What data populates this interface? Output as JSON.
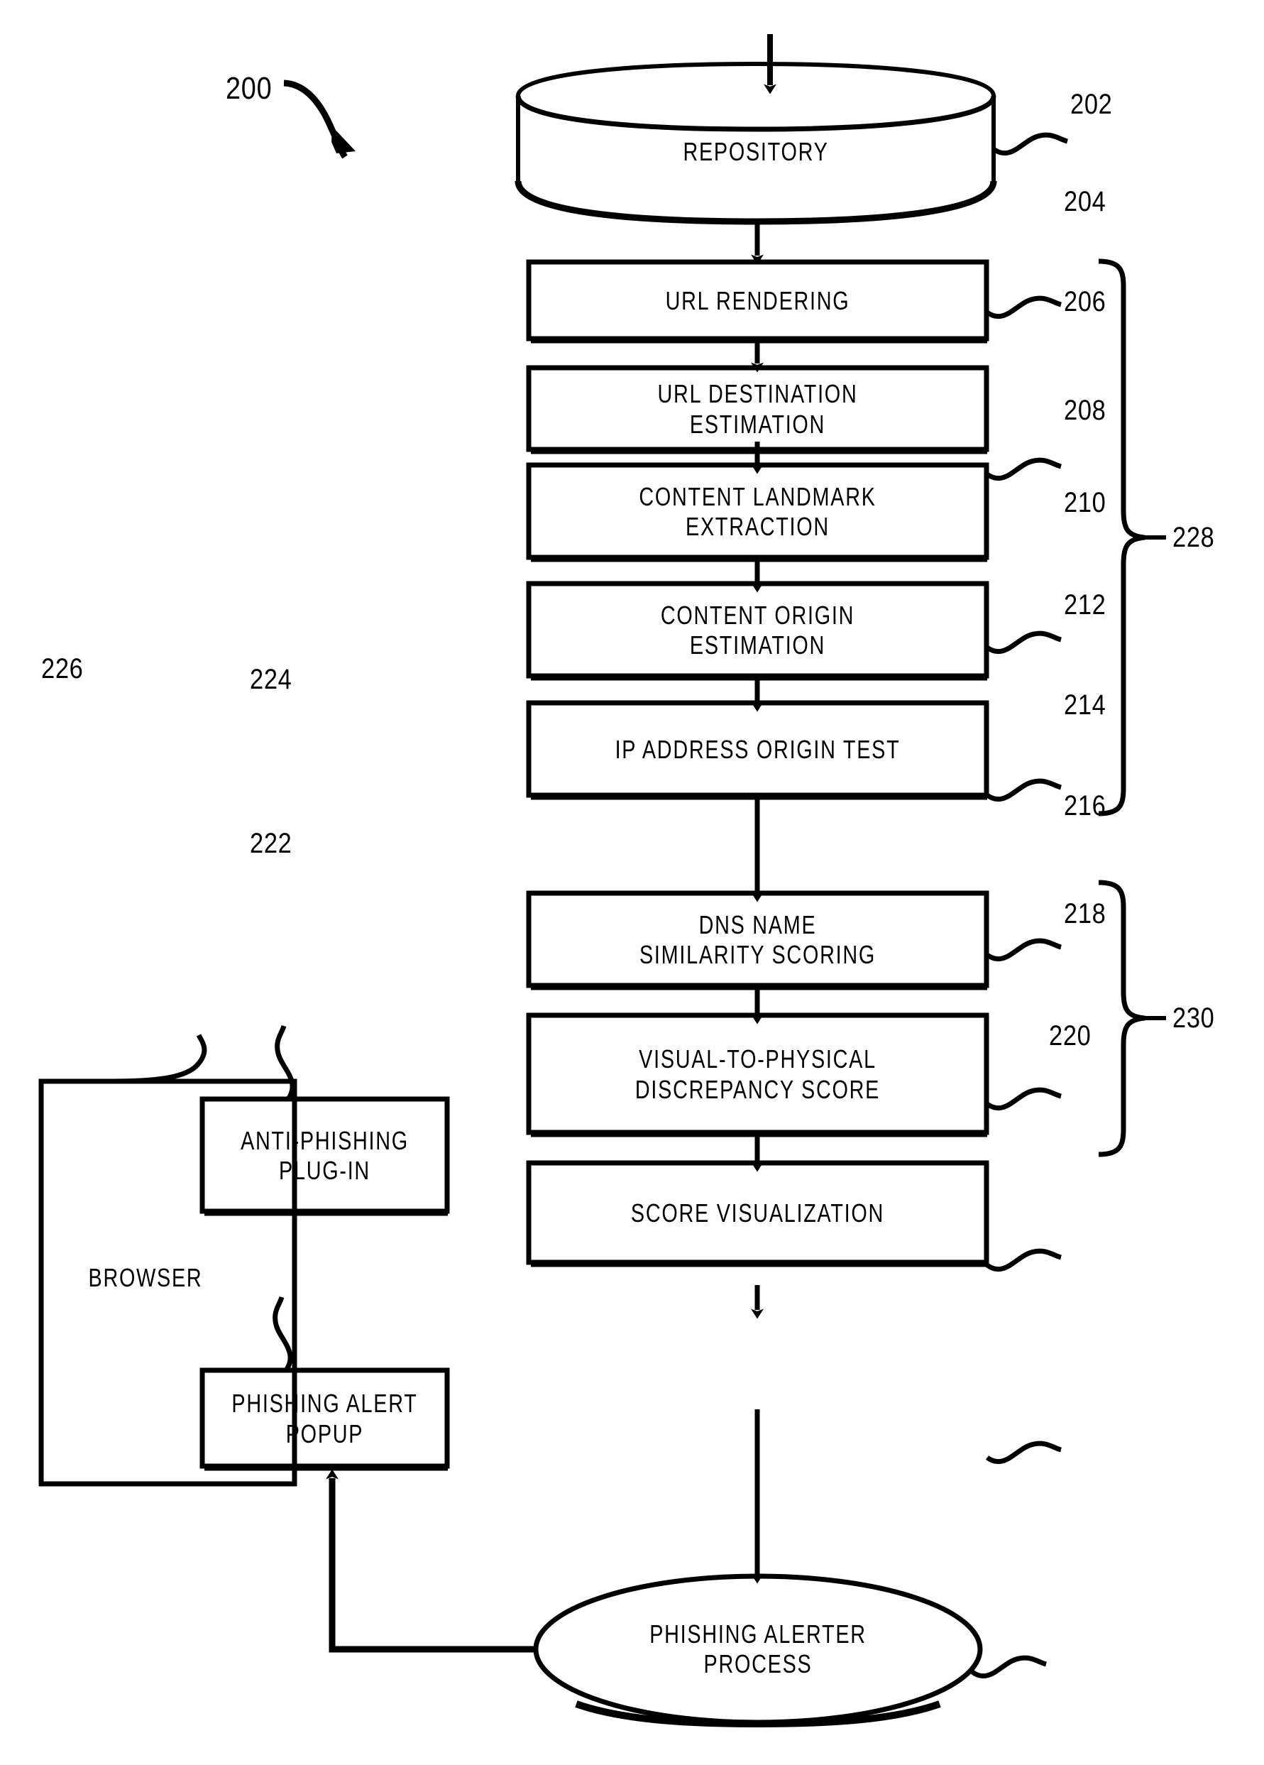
{
  "figure": {
    "number": "200",
    "title": "Anti-phishing detection pipeline block diagram"
  },
  "nodes": {
    "repository": {
      "label": "REPOSITORY",
      "ref": "202",
      "shape": "cylinder"
    },
    "url_rendering": {
      "label": "URL  RENDERING",
      "ref": "204",
      "shape": "process"
    },
    "url_destination_estimation": {
      "label": "URL  DESTINATION\nESTIMATION",
      "ref": "206",
      "shape": "process"
    },
    "content_landmark_extraction": {
      "label": "CONTENT  LANDMARK\nEXTRACTION",
      "ref": "208",
      "shape": "process"
    },
    "content_origin_estimation": {
      "label": "CONTENT  ORIGIN\nESTIMATION",
      "ref": "210",
      "shape": "process"
    },
    "ip_address_origin_test": {
      "label": "IP  ADDRESS  ORIGIN  TEST",
      "ref": "212",
      "shape": "process"
    },
    "dns_name_similarity_scoring": {
      "label": "DNS  NAME\nSIMILARITY  SCORING",
      "ref": "214",
      "shape": "process"
    },
    "visual_to_physical_discrepancy_score": {
      "label": "VISUAL-TO-PHYSICAL\nDISCREPANCY  SCORE",
      "ref": "216",
      "shape": "process"
    },
    "score_visualization": {
      "label": "SCORE  VISUALIZATION",
      "ref": "218",
      "shape": "process"
    },
    "phishing_alerter_process": {
      "label": "PHISHING  ALERTER\nPROCESS",
      "ref": "220",
      "shape": "ellipse"
    },
    "phishing_alert_popup": {
      "label": "PHISHING  ALERT\nPOPUP",
      "ref": "222",
      "shape": "process"
    },
    "anti_phishing_plugin": {
      "label": "ANTI-PHISHING\nPLUG-IN",
      "ref": "224",
      "shape": "process"
    },
    "browser": {
      "label": "BROWSER",
      "ref": "226",
      "shape": "container"
    }
  },
  "groups": {
    "group_228": {
      "ref": "228",
      "covers": [
        "204",
        "206",
        "208",
        "210"
      ]
    },
    "group_230": {
      "ref": "230",
      "covers": [
        "212",
        "214"
      ]
    }
  },
  "colors": {
    "stroke": "#000000",
    "background": "#ffffff",
    "text": "#000000"
  }
}
